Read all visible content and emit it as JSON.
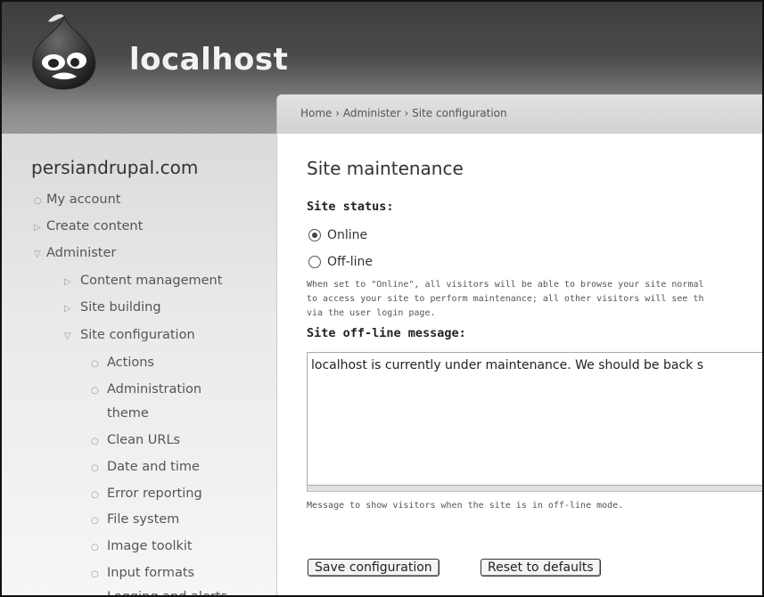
{
  "header": {
    "site_name": "localhost"
  },
  "breadcrumb": "Home › Administer › Site configuration",
  "sidebar": {
    "title": "persiandrupal.com",
    "items": [
      {
        "label": "My account",
        "bullet": "○"
      },
      {
        "label": "Create content",
        "bullet": "▷"
      },
      {
        "label": "Administer",
        "bullet": "▽"
      },
      {
        "label": "Content management",
        "bullet": "▷"
      },
      {
        "label": "Site building",
        "bullet": "▷"
      },
      {
        "label": "Site configuration",
        "bullet": "▽"
      },
      {
        "label": "Actions",
        "bullet": "○"
      },
      {
        "label": "Administration",
        "bullet": "○"
      },
      {
        "label": "theme",
        "bullet": ""
      },
      {
        "label": "Clean URLs",
        "bullet": "○"
      },
      {
        "label": "Date and time",
        "bullet": "○"
      },
      {
        "label": "Error reporting",
        "bullet": "○"
      },
      {
        "label": "File system",
        "bullet": "○"
      },
      {
        "label": "Image toolkit",
        "bullet": "○"
      },
      {
        "label": "Input formats",
        "bullet": "○"
      },
      {
        "label": "Logging and alerts",
        "bullet": "▷"
      }
    ]
  },
  "main": {
    "page_title": "Site maintenance",
    "site_status_label": "Site status:",
    "options": [
      {
        "label": "Online",
        "checked": true
      },
      {
        "label": "Off-line",
        "checked": false
      }
    ],
    "status_description": [
      "When set to \"Online\", all visitors will be able to browse your site normal",
      "to access your site to perform maintenance; all other visitors will see th",
      "via the user login page."
    ],
    "offline_message_label": "Site off-line message:",
    "offline_message_value": "localhost is currently under maintenance. We should be back s",
    "offline_message_description": "Message to show visitors when the site is in off-line mode.",
    "save_button": "Save configuration",
    "reset_button": "Reset to defaults"
  }
}
